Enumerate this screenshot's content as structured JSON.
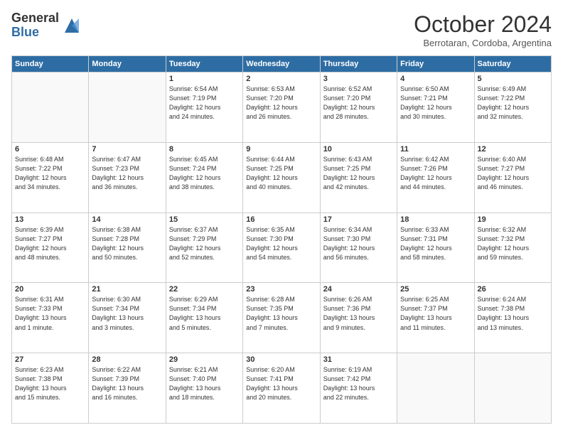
{
  "logo": {
    "general": "General",
    "blue": "Blue"
  },
  "header": {
    "month": "October 2024",
    "location": "Berrotaran, Cordoba, Argentina"
  },
  "days_of_week": [
    "Sunday",
    "Monday",
    "Tuesday",
    "Wednesday",
    "Thursday",
    "Friday",
    "Saturday"
  ],
  "weeks": [
    [
      {
        "day": "",
        "info": ""
      },
      {
        "day": "",
        "info": ""
      },
      {
        "day": "1",
        "info": "Sunrise: 6:54 AM\nSunset: 7:19 PM\nDaylight: 12 hours\nand 24 minutes."
      },
      {
        "day": "2",
        "info": "Sunrise: 6:53 AM\nSunset: 7:20 PM\nDaylight: 12 hours\nand 26 minutes."
      },
      {
        "day": "3",
        "info": "Sunrise: 6:52 AM\nSunset: 7:20 PM\nDaylight: 12 hours\nand 28 minutes."
      },
      {
        "day": "4",
        "info": "Sunrise: 6:50 AM\nSunset: 7:21 PM\nDaylight: 12 hours\nand 30 minutes."
      },
      {
        "day": "5",
        "info": "Sunrise: 6:49 AM\nSunset: 7:22 PM\nDaylight: 12 hours\nand 32 minutes."
      }
    ],
    [
      {
        "day": "6",
        "info": "Sunrise: 6:48 AM\nSunset: 7:22 PM\nDaylight: 12 hours\nand 34 minutes."
      },
      {
        "day": "7",
        "info": "Sunrise: 6:47 AM\nSunset: 7:23 PM\nDaylight: 12 hours\nand 36 minutes."
      },
      {
        "day": "8",
        "info": "Sunrise: 6:45 AM\nSunset: 7:24 PM\nDaylight: 12 hours\nand 38 minutes."
      },
      {
        "day": "9",
        "info": "Sunrise: 6:44 AM\nSunset: 7:25 PM\nDaylight: 12 hours\nand 40 minutes."
      },
      {
        "day": "10",
        "info": "Sunrise: 6:43 AM\nSunset: 7:25 PM\nDaylight: 12 hours\nand 42 minutes."
      },
      {
        "day": "11",
        "info": "Sunrise: 6:42 AM\nSunset: 7:26 PM\nDaylight: 12 hours\nand 44 minutes."
      },
      {
        "day": "12",
        "info": "Sunrise: 6:40 AM\nSunset: 7:27 PM\nDaylight: 12 hours\nand 46 minutes."
      }
    ],
    [
      {
        "day": "13",
        "info": "Sunrise: 6:39 AM\nSunset: 7:27 PM\nDaylight: 12 hours\nand 48 minutes."
      },
      {
        "day": "14",
        "info": "Sunrise: 6:38 AM\nSunset: 7:28 PM\nDaylight: 12 hours\nand 50 minutes."
      },
      {
        "day": "15",
        "info": "Sunrise: 6:37 AM\nSunset: 7:29 PM\nDaylight: 12 hours\nand 52 minutes."
      },
      {
        "day": "16",
        "info": "Sunrise: 6:35 AM\nSunset: 7:30 PM\nDaylight: 12 hours\nand 54 minutes."
      },
      {
        "day": "17",
        "info": "Sunrise: 6:34 AM\nSunset: 7:30 PM\nDaylight: 12 hours\nand 56 minutes."
      },
      {
        "day": "18",
        "info": "Sunrise: 6:33 AM\nSunset: 7:31 PM\nDaylight: 12 hours\nand 58 minutes."
      },
      {
        "day": "19",
        "info": "Sunrise: 6:32 AM\nSunset: 7:32 PM\nDaylight: 12 hours\nand 59 minutes."
      }
    ],
    [
      {
        "day": "20",
        "info": "Sunrise: 6:31 AM\nSunset: 7:33 PM\nDaylight: 13 hours\nand 1 minute."
      },
      {
        "day": "21",
        "info": "Sunrise: 6:30 AM\nSunset: 7:34 PM\nDaylight: 13 hours\nand 3 minutes."
      },
      {
        "day": "22",
        "info": "Sunrise: 6:29 AM\nSunset: 7:34 PM\nDaylight: 13 hours\nand 5 minutes."
      },
      {
        "day": "23",
        "info": "Sunrise: 6:28 AM\nSunset: 7:35 PM\nDaylight: 13 hours\nand 7 minutes."
      },
      {
        "day": "24",
        "info": "Sunrise: 6:26 AM\nSunset: 7:36 PM\nDaylight: 13 hours\nand 9 minutes."
      },
      {
        "day": "25",
        "info": "Sunrise: 6:25 AM\nSunset: 7:37 PM\nDaylight: 13 hours\nand 11 minutes."
      },
      {
        "day": "26",
        "info": "Sunrise: 6:24 AM\nSunset: 7:38 PM\nDaylight: 13 hours\nand 13 minutes."
      }
    ],
    [
      {
        "day": "27",
        "info": "Sunrise: 6:23 AM\nSunset: 7:38 PM\nDaylight: 13 hours\nand 15 minutes."
      },
      {
        "day": "28",
        "info": "Sunrise: 6:22 AM\nSunset: 7:39 PM\nDaylight: 13 hours\nand 16 minutes."
      },
      {
        "day": "29",
        "info": "Sunrise: 6:21 AM\nSunset: 7:40 PM\nDaylight: 13 hours\nand 18 minutes."
      },
      {
        "day": "30",
        "info": "Sunrise: 6:20 AM\nSunset: 7:41 PM\nDaylight: 13 hours\nand 20 minutes."
      },
      {
        "day": "31",
        "info": "Sunrise: 6:19 AM\nSunset: 7:42 PM\nDaylight: 13 hours\nand 22 minutes."
      },
      {
        "day": "",
        "info": ""
      },
      {
        "day": "",
        "info": ""
      }
    ]
  ]
}
